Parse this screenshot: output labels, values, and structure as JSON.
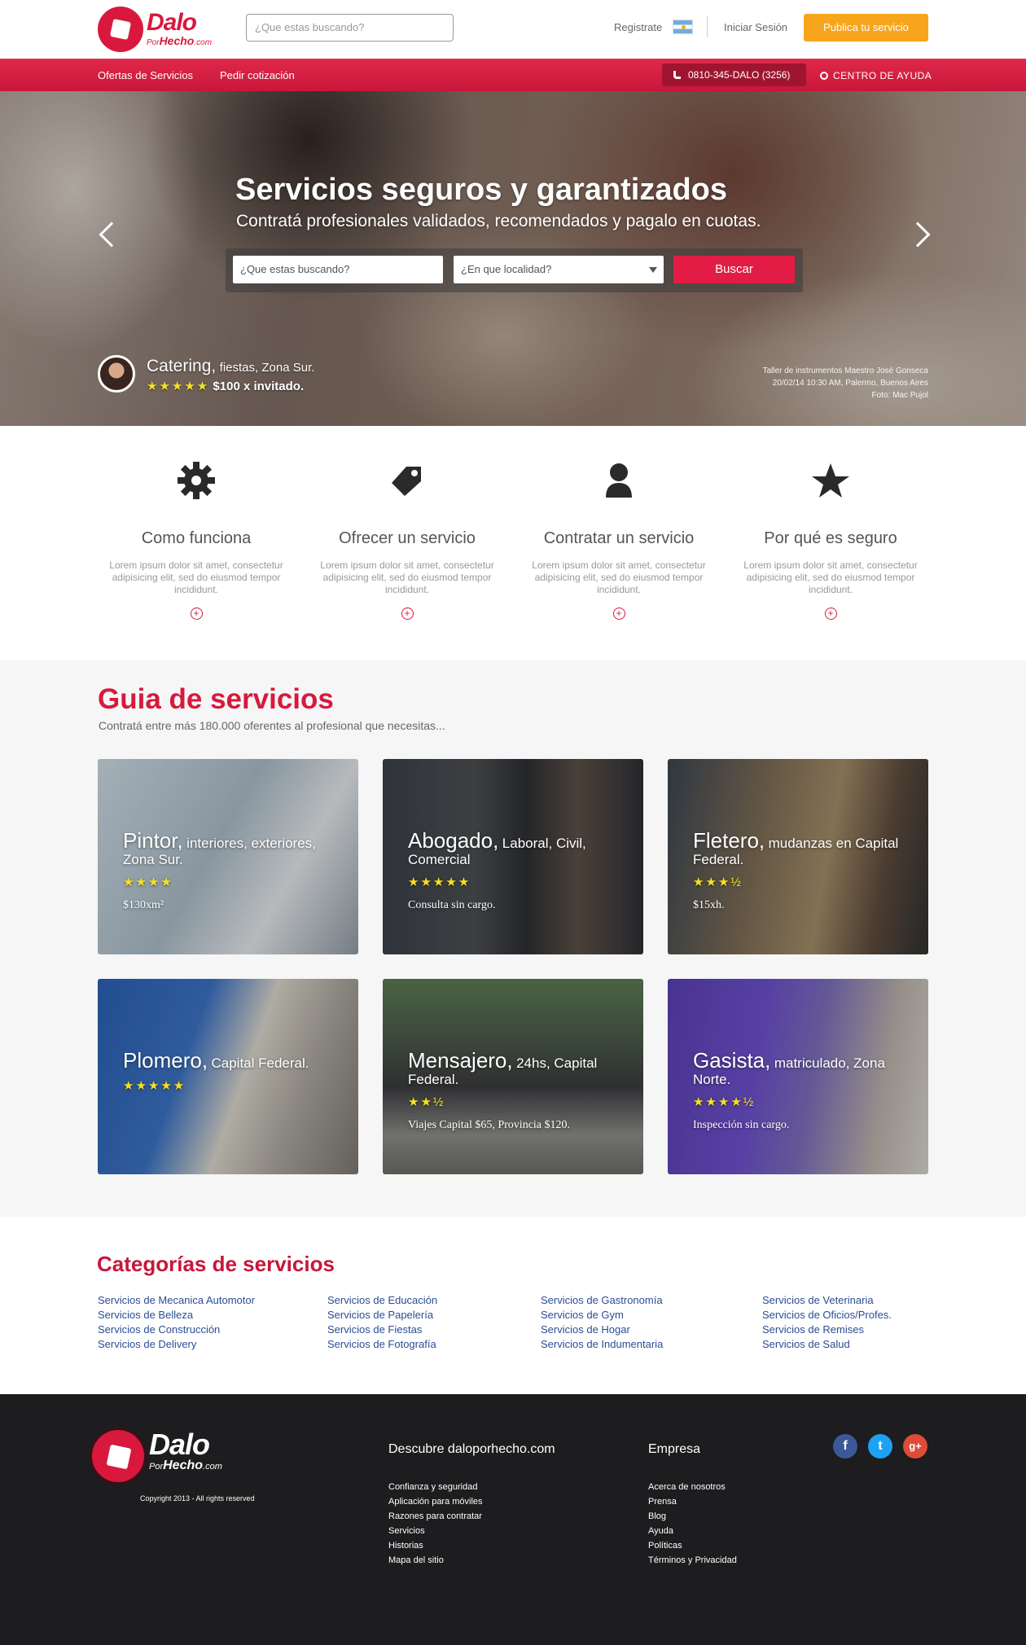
{
  "header": {
    "logo_main": "Dalo",
    "logo_por": "Por",
    "logo_hecho": "Hecho",
    "logo_com": ".com",
    "search_placeholder": "¿Que estas buscando?",
    "registrate": "Registrate",
    "login": "Iniciar Sesión",
    "publica": "Publica tu servicio"
  },
  "nav": {
    "ofertas": "Ofertas de Servicios",
    "pedir": "Pedir cotización",
    "phone": "0810-345-DALO (3256)",
    "ayuda": "CENTRO DE AYUDA"
  },
  "hero": {
    "title": "Servicios seguros y garantizados",
    "subtitle": "Contratá profesionales validados, recomendados y pagalo en cuotas.",
    "search_placeholder": "¿Que estas buscando?",
    "location_placeholder": "¿En que localidad?",
    "buscar": "Buscar",
    "caption_category": "Catering,",
    "caption_detail": "fiestas, Zona Sur.",
    "caption_stars": "★★★★★",
    "caption_price": "$100 x invitado.",
    "credit_line1": "Taller de instrumentos Maestro José Gonseca",
    "credit_line2": "20/02/14 10:30 AM, Palermo, Buenos Aires",
    "credit_line3": "Foto: Mac Pujol"
  },
  "features": [
    {
      "title": "Como funciona",
      "desc": "Lorem ipsum dolor sit amet, consectetur adipisicing elit, sed do eiusmod tempor incididunt.",
      "icon": "gear-icon"
    },
    {
      "title": "Ofrecer un servicio",
      "desc": "Lorem ipsum dolor sit amet, consectetur adipisicing elit, sed do eiusmod tempor incididunt.",
      "icon": "tag-icon"
    },
    {
      "title": "Contratar un servicio",
      "desc": "Lorem ipsum dolor sit amet, consectetur adipisicing elit, sed do eiusmod tempor incididunt.",
      "icon": "person-icon"
    },
    {
      "title": "Por qué es seguro",
      "desc": "Lorem ipsum dolor sit amet, consectetur adipisicing elit, sed do eiusmod tempor incididunt.",
      "icon": "star-icon"
    }
  ],
  "plus_glyph": "+",
  "guia": {
    "title": "Guia de servicios",
    "subtitle": "Contratá entre más 180.000 oferentes al profesional que necesitas...",
    "cards": [
      {
        "title": "Pintor,",
        "detail": "interiores, exteriores, Zona Sur.",
        "stars": "★★★★",
        "price": "$130xm²"
      },
      {
        "title": "Abogado,",
        "detail": "Laboral, Civil, Comercial",
        "stars": "★★★★★",
        "price": "Consulta sin cargo."
      },
      {
        "title": "Fletero,",
        "detail": "mudanzas en Capital Federal.",
        "stars": "★★★½",
        "price": "$15xh."
      },
      {
        "title": "Plomero,",
        "detail": "Capital Federal.",
        "stars": "★★★★★",
        "price": ""
      },
      {
        "title": "Mensajero,",
        "detail": "24hs, Capital Federal.",
        "stars": "★★½",
        "price": "Viajes Capital $65, Provincia $120."
      },
      {
        "title": "Gasista,",
        "detail": "matriculado, Zona Norte.",
        "stars": "★★★★½",
        "price": "Inspección sin cargo."
      }
    ]
  },
  "categorias": {
    "title": "Categorías de servicios",
    "columns": [
      [
        "Servicios de Mecanica Automotor",
        "Servicios de Belleza",
        "Servicios de Construcción",
        "Servicios de Delivery"
      ],
      [
        "Servicios de Educación",
        "Servicios de Papelería",
        "Servicios de Fiestas",
        "Servicios de Fotografía"
      ],
      [
        "Servicios de Gastronomía",
        "Servicios de Gym",
        "Servicios de Hogar",
        "Servicios de Indumentaria"
      ],
      [
        "Servicios de Veterinaria",
        "Servicios de Oficios/Profes.",
        "Servicios de Remises",
        "Servicios de Salud"
      ]
    ]
  },
  "footer": {
    "copyright": "Copyright 2013 - All rights reserved",
    "col1_title": "Descubre daloporhecho.com",
    "col1_links": [
      "Confianza y seguridad",
      "Aplicación para móviles",
      "Razones para contratar",
      "Servicios",
      "Historias",
      "Mapa del sitio"
    ],
    "col2_title": "Empresa",
    "col2_links": [
      "Acerca de nosotros",
      "Prensa",
      "Blog",
      "Ayuda",
      "Políticas",
      "Términos y Privacidad"
    ],
    "social": [
      {
        "label": "f",
        "color": "#3b5998",
        "icon": "facebook-icon"
      },
      {
        "label": "t",
        "color": "#1da1f2",
        "icon": "twitter-icon"
      },
      {
        "label": "g+",
        "color": "#dd4b39",
        "icon": "google-plus-icon"
      }
    ]
  },
  "colors": {
    "brand_red": "#d8193d",
    "orange": "#f7a51c",
    "link_blue": "#2b4d93",
    "footer_bg": "#1d1c1e"
  }
}
